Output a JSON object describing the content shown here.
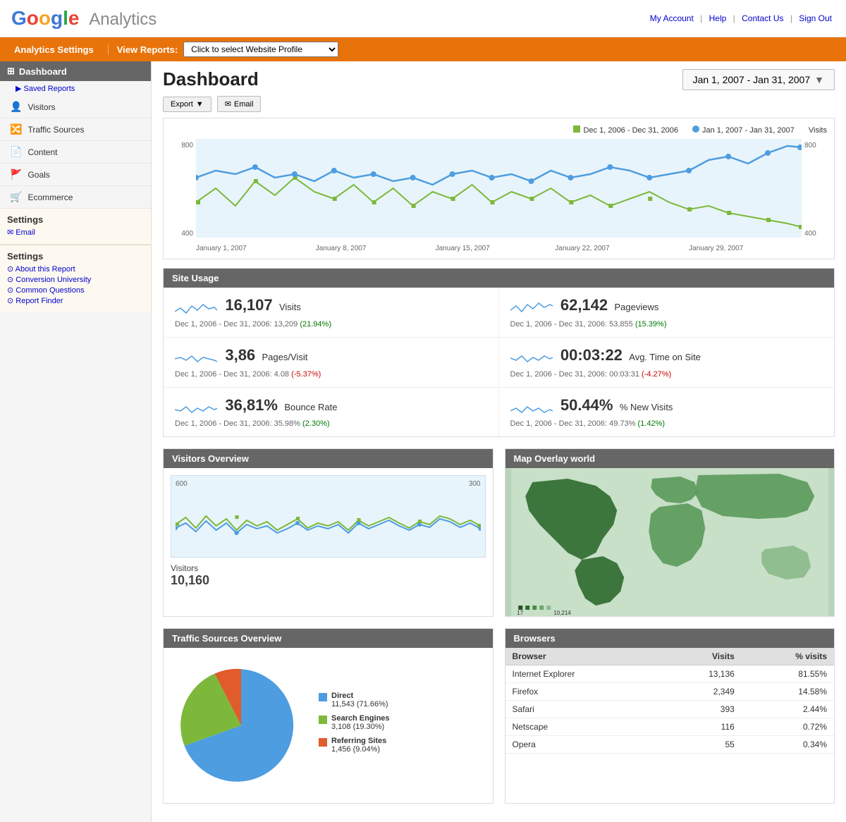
{
  "header": {
    "logo_google": "Google",
    "logo_analytics": "Analytics",
    "nav_links": {
      "my_account": "My Account",
      "help": "Help",
      "contact_us": "Contact Us",
      "sign_out": "Sign Out"
    }
  },
  "orange_bar": {
    "analytics_settings": "Analytics Settings",
    "view_reports": "View Reports:",
    "profile_placeholder": "Click to select Website Profile"
  },
  "sidebar": {
    "dashboard_label": "Dashboard",
    "saved_reports": "▶ Saved Reports",
    "nav_items": [
      {
        "label": "Visitors",
        "icon": "👤"
      },
      {
        "label": "Traffic Sources",
        "icon": "🔀"
      },
      {
        "label": "Content",
        "icon": "📄"
      },
      {
        "label": "Goals",
        "icon": "🚩"
      },
      {
        "label": "Ecommerce",
        "icon": "🛒"
      }
    ],
    "settings": {
      "title": "Settings",
      "email_link": "✉ Email"
    },
    "help": {
      "title": "Settings",
      "links": [
        "About this Report",
        "Conversion University",
        "Common Questions",
        "Report Finder"
      ]
    }
  },
  "dashboard": {
    "title": "Dashboard",
    "date_range": "Jan 1, 2007 - Jan 31, 2007",
    "export_label": "Export",
    "email_label": "✉ Email",
    "chart_legend": {
      "prev_period": "Dec 1, 2006 - Dec 31, 2006",
      "curr_period": "Jan 1, 2007 - Jan 31, 2007",
      "metric": "Visits"
    },
    "x_axis_labels": [
      "January 1, 2007",
      "January 8, 2007",
      "January 15, 2007",
      "January 22, 2007",
      "January 29, 2007"
    ],
    "y_axis_labels_left": [
      "800",
      "400"
    ],
    "y_axis_labels_right": [
      "800",
      "400"
    ]
  },
  "site_usage": {
    "title": "Site Usage",
    "metrics": [
      {
        "value": "16,107",
        "label": "Visits",
        "compare": "Dec 1, 2006 - Dec 31, 2006: 13,209",
        "change": "(21.94%)",
        "positive": true
      },
      {
        "value": "62,142",
        "label": "Pageviews",
        "compare": "Dec 1, 2006 - Dec 31, 2006: 53,855",
        "change": "(15.39%)",
        "positive": true
      },
      {
        "value": "3,86",
        "label": "Pages/Visit",
        "compare": "Dec 1, 2006 - Dec 31, 2006: 4.08",
        "change": "(-5.37%)",
        "positive": false
      },
      {
        "value": "00:03:22",
        "label": "Avg. Time on Site",
        "compare": "Dec 1, 2006 - Dec 31, 2006: 00:03:31",
        "change": "(-4.27%)",
        "positive": false
      },
      {
        "value": "36,81%",
        "label": "Bounce Rate",
        "compare": "Dec 1, 2006 - Dec 31, 2006: 35.98%",
        "change": "(2.30%)",
        "positive": true
      },
      {
        "value": "50.44%",
        "label": "% New Visits",
        "compare": "Dec 1, 2006 - Dec 31, 2006: 49.73%",
        "change": "(1.42%)",
        "positive": true
      }
    ]
  },
  "visitors_overview": {
    "title": "Visitors Overview",
    "metric_label": "Visitors",
    "metric_value": "10,160",
    "y_max": "600",
    "y_mid": "300"
  },
  "map_overlay": {
    "title": "Map Overlay world",
    "legend_min": "17",
    "legend_max": "10,214"
  },
  "traffic_sources": {
    "title": "Traffic Sources Overview",
    "segments": [
      {
        "label": "Direct",
        "value": "11,543",
        "pct": "(71.66%)",
        "color": "#4d9de0"
      },
      {
        "label": "Search Engines",
        "value": "3,108",
        "pct": "(19.30%)",
        "color": "#7db83a"
      },
      {
        "label": "Referring Sites",
        "value": "1,456",
        "pct": "(9.04%)",
        "color": "#e05c2a"
      }
    ]
  },
  "browsers": {
    "title": "Browsers",
    "columns": [
      "Browser",
      "Visits",
      "% visits"
    ],
    "rows": [
      {
        "browser": "Internet Explorer",
        "visits": "13,136",
        "pct": "81.55%"
      },
      {
        "browser": "Firefox",
        "visits": "2,349",
        "pct": "14.58%"
      },
      {
        "browser": "Safari",
        "visits": "393",
        "pct": "2.44%"
      },
      {
        "browser": "Netscape",
        "visits": "116",
        "pct": "0.72%"
      },
      {
        "browser": "Opera",
        "visits": "55",
        "pct": "0.34%"
      }
    ]
  }
}
